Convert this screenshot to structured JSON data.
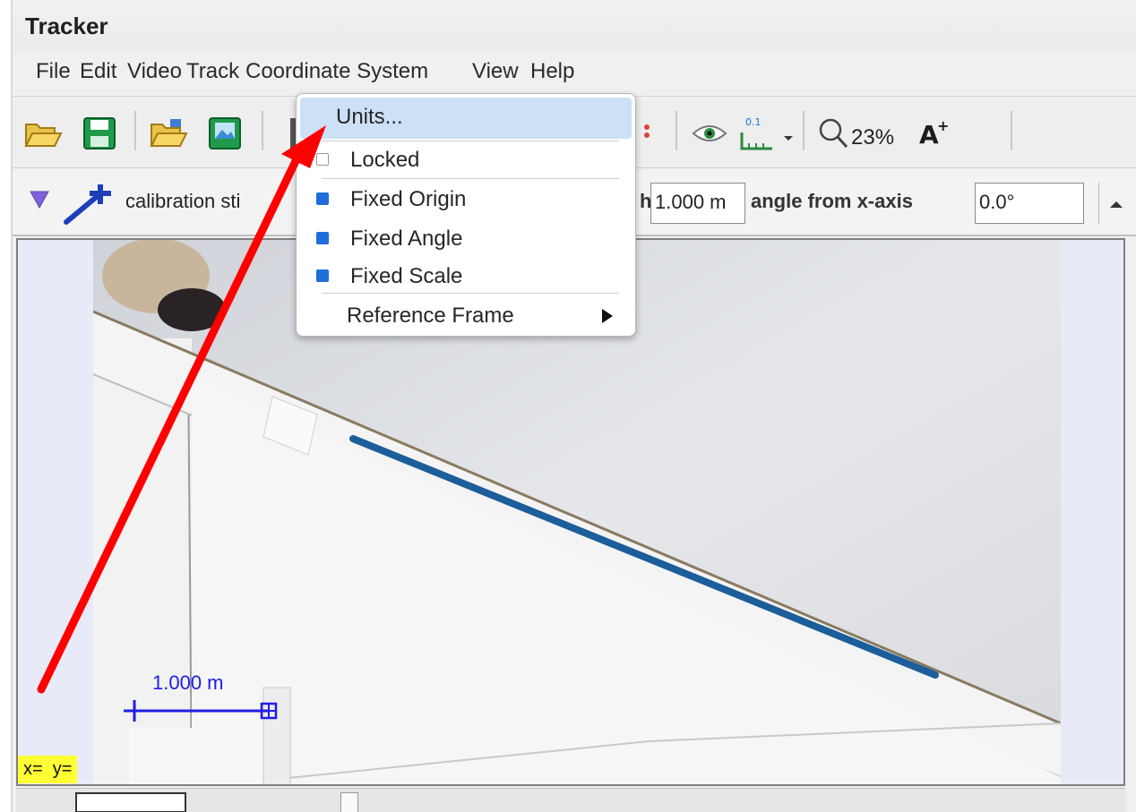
{
  "window": {
    "title": "Tracker"
  },
  "menu": [
    "File",
    "Edit",
    "Video",
    "Track",
    "Coordinate System",
    "View",
    "Help"
  ],
  "toolbar": {
    "zoom_value": "23%"
  },
  "calibration": {
    "track_label": "calibration sti",
    "length_label_fragment": "h",
    "length_value": "1.000 m",
    "angle_label": "angle from x-axis",
    "angle_value": "0.0°"
  },
  "popup_menu": {
    "items": [
      {
        "label": "Units..."
      },
      {
        "label": "Locked",
        "checked": false
      },
      {
        "label": "Fixed Origin",
        "checked": true
      },
      {
        "label": "Fixed Angle",
        "checked": true
      },
      {
        "label": "Fixed Scale",
        "checked": true
      },
      {
        "label": "Reference Frame"
      }
    ]
  },
  "video": {
    "scale_label": "1.000 m",
    "coord_readout": "x=  y="
  },
  "colors": {
    "accent_blue": "#1e6fd9",
    "annotation_red": "#ff0000",
    "readout_yellow": "#ffff33",
    "track_blue": "#1e1ee6"
  }
}
